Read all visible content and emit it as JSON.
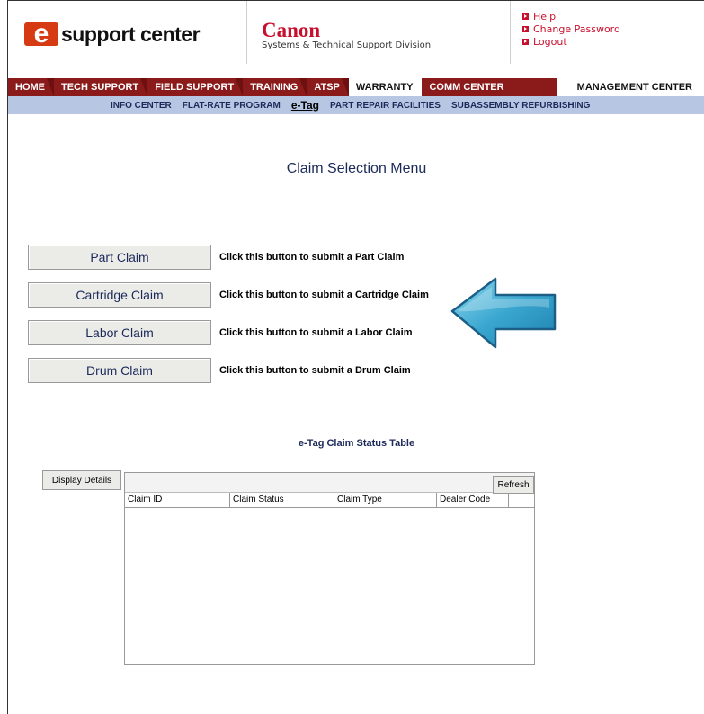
{
  "header": {
    "logo_e": "e",
    "logo_text": "support center",
    "canon_brand": "Canon",
    "canon_sub": "Systems & Technical Support Division",
    "links": [
      "Help",
      "Change Password",
      "Logout"
    ]
  },
  "nav": {
    "tabs": [
      "HOME",
      "TECH SUPPORT",
      "FIELD SUPPORT",
      "TRAINING",
      "ATSP",
      "WARRANTY",
      "COMM CENTER"
    ],
    "active": "WARRANTY",
    "mgmt": "MANAGEMENT CENTER"
  },
  "subnav": [
    "INFO CENTER",
    "FLAT-RATE PROGRAM",
    "e-Tag",
    "PART REPAIR FACILITIES",
    "SUBASSEMBLY REFURBISHING"
  ],
  "page_title": "Claim Selection Menu",
  "claims": [
    {
      "label": "Part Claim",
      "desc": "Click this button to submit a Part Claim"
    },
    {
      "label": "Cartridge Claim",
      "desc": "Click this button to submit a Cartridge Claim"
    },
    {
      "label": "Labor Claim",
      "desc": "Click this button to submit a Labor Claim"
    },
    {
      "label": "Drum Claim",
      "desc": "Click this button to submit a Drum Claim"
    }
  ],
  "status_table": {
    "title": "e-Tag Claim Status Table",
    "display_details": "Display Details",
    "refresh": "Refresh",
    "columns": [
      "Claim ID",
      "Claim Status",
      "Claim Type",
      "Dealer Code"
    ]
  },
  "colors": {
    "nav_bg": "#8b1a1a",
    "subnav_bg": "#b7c7e3",
    "brand_red": "#c8102e",
    "title_blue": "#1c2a5a",
    "arrow": "#4fb3d8"
  }
}
